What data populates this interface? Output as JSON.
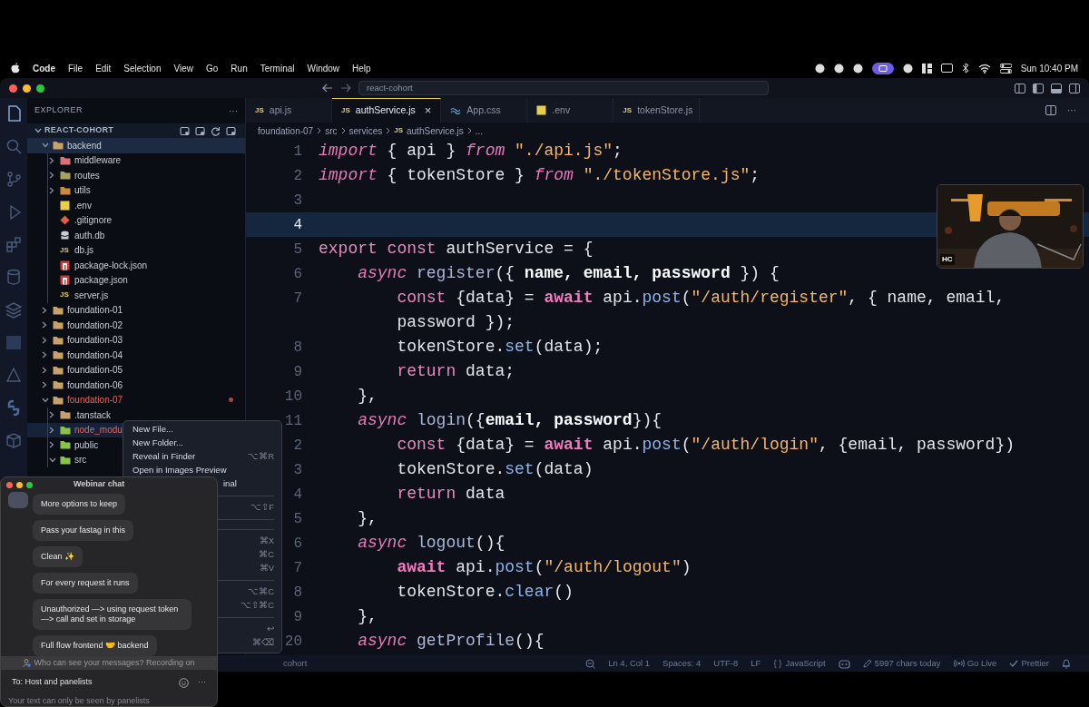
{
  "menu_bar": {
    "app": "Code",
    "items": [
      "File",
      "Edit",
      "Selection",
      "View",
      "Go",
      "Run",
      "Terminal",
      "Window",
      "Help"
    ],
    "clock": "Sun 10:40 PM"
  },
  "window": {
    "search": "react-cohort"
  },
  "explorer": {
    "title": "EXPLORER",
    "more": "···",
    "root": "REACT-COHORT",
    "tree": [
      {
        "label": "backend",
        "kind": "folder",
        "expanded": true,
        "selected": true,
        "modified": false,
        "color": "#c9a26b",
        "children": [
          {
            "label": "middleware",
            "kind": "folder",
            "expanded": false,
            "selected": false,
            "modified": false,
            "color": "#d9707a"
          },
          {
            "label": "routes",
            "kind": "folder",
            "expanded": false,
            "selected": false,
            "modified": false,
            "color": "#a7a35e"
          },
          {
            "label": "utils",
            "kind": "folder",
            "expanded": false,
            "selected": false,
            "modified": false,
            "color": "#c98a3e"
          },
          {
            "label": ".env",
            "kind": "env",
            "selected": false,
            "modified": false
          },
          {
            "label": ".gitignore",
            "kind": "git",
            "selected": false,
            "modified": false
          },
          {
            "label": "auth.db",
            "kind": "db",
            "selected": false,
            "modified": false
          },
          {
            "label": "db.js",
            "kind": "js",
            "badge": "JS",
            "selected": false,
            "modified": false
          },
          {
            "label": "package-lock.json",
            "kind": "npm",
            "selected": false,
            "modified": false
          },
          {
            "label": "package.json",
            "kind": "npm",
            "selected": false,
            "modified": false
          },
          {
            "label": "server.js",
            "kind": "js",
            "badge": "JS",
            "selected": false,
            "modified": false
          }
        ]
      },
      {
        "label": "foundation-01",
        "kind": "folder",
        "expanded": false,
        "selected": false,
        "modified": false,
        "color": "#c9a26b"
      },
      {
        "label": "foundation-02",
        "kind": "folder",
        "expanded": false,
        "selected": false,
        "modified": false,
        "color": "#c9a26b"
      },
      {
        "label": "foundation-03",
        "kind": "folder",
        "expanded": false,
        "selected": false,
        "modified": false,
        "color": "#c9a26b"
      },
      {
        "label": "foundation-04",
        "kind": "folder",
        "expanded": false,
        "selected": false,
        "modified": false,
        "color": "#c9a26b"
      },
      {
        "label": "foundation-05",
        "kind": "folder",
        "expanded": false,
        "selected": false,
        "modified": false,
        "color": "#c9a26b"
      },
      {
        "label": "foundation-06",
        "kind": "folder",
        "expanded": false,
        "selected": false,
        "modified": false,
        "color": "#c9a26b"
      },
      {
        "label": "foundation-07",
        "kind": "folder",
        "expanded": true,
        "selected": false,
        "modified": true,
        "color": "#c9a26b",
        "children": [
          {
            "label": ".tanstack",
            "kind": "folder",
            "expanded": false,
            "selected": false,
            "modified": false,
            "color": "#c9a26b"
          },
          {
            "label": "node_modu",
            "kind": "folder",
            "expanded": false,
            "selected": true,
            "modified": true,
            "color": "#8bc34a"
          },
          {
            "label": "public",
            "kind": "folder",
            "expanded": false,
            "selected": false,
            "modified": false,
            "color": "#8bc34a"
          },
          {
            "label": "src",
            "kind": "folder",
            "expanded": true,
            "selected": false,
            "modified": false,
            "color": "#8bc34a"
          }
        ]
      }
    ]
  },
  "tabs": [
    {
      "label": "api.js",
      "kind": "js",
      "badge": "JS",
      "selected": false
    },
    {
      "label": "authService.js",
      "kind": "js",
      "badge": "JS",
      "selected": true,
      "close": "×"
    },
    {
      "label": "App.css",
      "kind": "css",
      "selected": false
    },
    {
      "label": ".env",
      "kind": "env",
      "selected": false
    },
    {
      "label": "tokenStore.js",
      "kind": "js",
      "badge": "JS",
      "selected": false
    }
  ],
  "breadcrumb": [
    {
      "label": "foundation-07"
    },
    {
      "label": "src"
    },
    {
      "label": "services"
    },
    {
      "label": "authService.js",
      "badge": "JS"
    },
    {
      "label": "..."
    }
  ],
  "code": [
    {
      "n": "1",
      "current": false,
      "tokens": [
        {
          "text": "import",
          "kind": "kw"
        },
        {
          "text": " { api } ",
          "kind": "txt"
        },
        {
          "text": "from",
          "kind": "kw"
        },
        {
          "text": " \"./api.js\"",
          "kind": "str"
        },
        {
          "text": ";",
          "kind": "txt"
        }
      ]
    },
    {
      "n": "2",
      "current": false,
      "tokens": [
        {
          "text": "import",
          "kind": "kw"
        },
        {
          "text": " { tokenStore } ",
          "kind": "txt"
        },
        {
          "text": "from",
          "kind": "kw"
        },
        {
          "text": " \"./tokenStore.js\"",
          "kind": "str"
        },
        {
          "text": ";",
          "kind": "txt"
        }
      ]
    },
    {
      "n": "3",
      "current": false
    },
    {
      "n": "4",
      "current": true
    },
    {
      "n": "5",
      "current": false,
      "tokens": [
        {
          "text": "export const",
          "kind": "decl"
        },
        {
          "text": " authService = {",
          "kind": "txt"
        }
      ]
    },
    {
      "n": "6",
      "current": false,
      "tokens": [
        {
          "text": "    async",
          "kind": "kw"
        },
        {
          "text": " register",
          "kind": "fn"
        },
        {
          "text": "({ ",
          "kind": "txt"
        },
        {
          "text": "name, email, password",
          "kind": "param"
        },
        {
          "text": " }) {",
          "kind": "txt"
        }
      ]
    },
    {
      "n": "7",
      "current": false,
      "tokens": [
        {
          "text": "        const",
          "kind": "decl"
        },
        {
          "text": " {data} = ",
          "kind": "txt"
        },
        {
          "text": "await",
          "kind": "kwb"
        },
        {
          "text": " api.",
          "kind": "txt"
        },
        {
          "text": "post",
          "kind": "prop"
        },
        {
          "text": "(",
          "kind": "txt"
        },
        {
          "text": "\"/auth/register\"",
          "kind": "str"
        },
        {
          "text": ", { name, email,",
          "kind": "txt"
        }
      ]
    },
    {
      "current": false,
      "tokens": [
        {
          "text": "        password });",
          "kind": "txt"
        }
      ]
    },
    {
      "n": "8",
      "current": false,
      "tokens": [
        {
          "text": "        tokenStore.",
          "kind": "txt"
        },
        {
          "text": "set",
          "kind": "prop"
        },
        {
          "text": "(data);",
          "kind": "txt"
        }
      ]
    },
    {
      "n": "9",
      "current": false,
      "tokens": [
        {
          "text": "        return",
          "kind": "decl"
        },
        {
          "text": " data;",
          "kind": "txt"
        }
      ]
    },
    {
      "n": "10",
      "current": false,
      "tokens": [
        {
          "text": "    },",
          "kind": "txt"
        }
      ]
    },
    {
      "n": "11",
      "current": false,
      "tokens": [
        {
          "text": "    async",
          "kind": "kw"
        },
        {
          "text": " login",
          "kind": "fn"
        },
        {
          "text": "({",
          "kind": "txt"
        },
        {
          "text": "email, password",
          "kind": "param"
        },
        {
          "text": "}){",
          "kind": "txt"
        }
      ]
    },
    {
      "n": "2",
      "current": false,
      "tokens": [
        {
          "text": "        const",
          "kind": "decl"
        },
        {
          "text": " {data} = ",
          "kind": "txt"
        },
        {
          "text": "await",
          "kind": "kwb"
        },
        {
          "text": " api.",
          "kind": "txt"
        },
        {
          "text": "post",
          "kind": "prop"
        },
        {
          "text": "(",
          "kind": "txt"
        },
        {
          "text": "\"/auth/login\"",
          "kind": "str"
        },
        {
          "text": ", {email, password})",
          "kind": "txt"
        }
      ]
    },
    {
      "n": "3",
      "current": false,
      "tokens": [
        {
          "text": "        tokenStore.",
          "kind": "txt"
        },
        {
          "text": "set",
          "kind": "prop"
        },
        {
          "text": "(data)",
          "kind": "txt"
        }
      ]
    },
    {
      "n": "4",
      "current": false,
      "tokens": [
        {
          "text": "        return",
          "kind": "decl"
        },
        {
          "text": " data",
          "kind": "txt"
        }
      ]
    },
    {
      "n": "5",
      "current": false,
      "tokens": [
        {
          "text": "    },",
          "kind": "txt"
        }
      ]
    },
    {
      "n": "6",
      "current": false,
      "tokens": [
        {
          "text": "    async",
          "kind": "kw"
        },
        {
          "text": " logout",
          "kind": "fn"
        },
        {
          "text": "(){",
          "kind": "txt"
        }
      ]
    },
    {
      "n": "7",
      "current": false,
      "tokens": [
        {
          "text": "        await",
          "kind": "kwb"
        },
        {
          "text": " api.",
          "kind": "txt"
        },
        {
          "text": "post",
          "kind": "prop"
        },
        {
          "text": "(",
          "kind": "txt"
        },
        {
          "text": "\"/auth/logout\"",
          "kind": "str"
        },
        {
          "text": ")",
          "kind": "txt"
        }
      ]
    },
    {
      "n": "8",
      "current": false,
      "tokens": [
        {
          "text": "        tokenStore.",
          "kind": "txt"
        },
        {
          "text": "clear",
          "kind": "prop"
        },
        {
          "text": "()",
          "kind": "txt"
        }
      ]
    },
    {
      "n": "9",
      "current": false,
      "tokens": [
        {
          "text": "    },",
          "kind": "txt"
        }
      ]
    },
    {
      "n": "20",
      "current": false,
      "tokens": [
        {
          "text": "    async",
          "kind": "kw"
        },
        {
          "text": " getProfile",
          "kind": "fn"
        },
        {
          "text": "(){",
          "kind": "txt"
        }
      ]
    }
  ],
  "context_menu": [
    {
      "kind": "item",
      "label": "New File..."
    },
    {
      "kind": "item",
      "label": "New Folder..."
    },
    {
      "kind": "item",
      "label": "Reveal in Finder",
      "shortcut": "⌥⌘R"
    },
    {
      "kind": "item",
      "label": "Open in Images Preview"
    },
    {
      "kind": "clipped",
      "label": "inal"
    },
    {
      "kind": "separator"
    },
    {
      "kind": "item",
      "shortcut": "⌥⇧F"
    },
    {
      "kind": "separator"
    },
    {
      "kind": "separator"
    },
    {
      "kind": "item",
      "shortcut": "⌘X"
    },
    {
      "kind": "item",
      "shortcut": "⌘C"
    },
    {
      "kind": "item",
      "shortcut": "⌘V"
    },
    {
      "kind": "separator"
    },
    {
      "kind": "item",
      "shortcut": "⌥⌘C"
    },
    {
      "kind": "item",
      "shortcut": "⌥⇧⌘C"
    },
    {
      "kind": "separator"
    },
    {
      "kind": "item",
      "shortcut": "↩"
    },
    {
      "kind": "item",
      "shortcut": "⌘⌫"
    }
  ],
  "status_bar": {
    "left": "cohort",
    "items": [
      {
        "kind": "zoom"
      },
      {
        "kind": "text",
        "label": "Ln 4, Col 1"
      },
      {
        "kind": "text",
        "label": "Spaces: 4"
      },
      {
        "kind": "text",
        "label": "UTF-8"
      },
      {
        "kind": "text",
        "label": "LF"
      },
      {
        "kind": "braces",
        "glyph": "{ }",
        "label": "JavaScript"
      },
      {
        "kind": "copilot"
      },
      {
        "kind": "pencil",
        "label": "5997 chars today"
      },
      {
        "kind": "live",
        "label": "Go Live"
      },
      {
        "kind": "check",
        "label": "Prettier"
      },
      {
        "kind": "bell"
      }
    ]
  },
  "video": {
    "kind": "picture",
    "badge": "HC"
  },
  "webinar_chat": {
    "title": "Webinar chat",
    "messages": [
      {
        "text": "More options to keep",
        "avatar": true
      },
      {
        "text": "Pass your fastag in this",
        "avatar": false
      },
      {
        "text": "Clean ✨",
        "avatar": false
      },
      {
        "text": "For every request it runs",
        "avatar": false
      },
      {
        "text": "Unauthorized —> using request token —> call and set in storage",
        "avatar": false
      },
      {
        "text": "Full flow frontend 🤝 backend",
        "avatar": false
      }
    ],
    "notice": "Who can see your messages? Recording on",
    "recipient": "To: Host and panelists",
    "more": "···",
    "placeholder": "Your text can only be seen by panelists"
  }
}
